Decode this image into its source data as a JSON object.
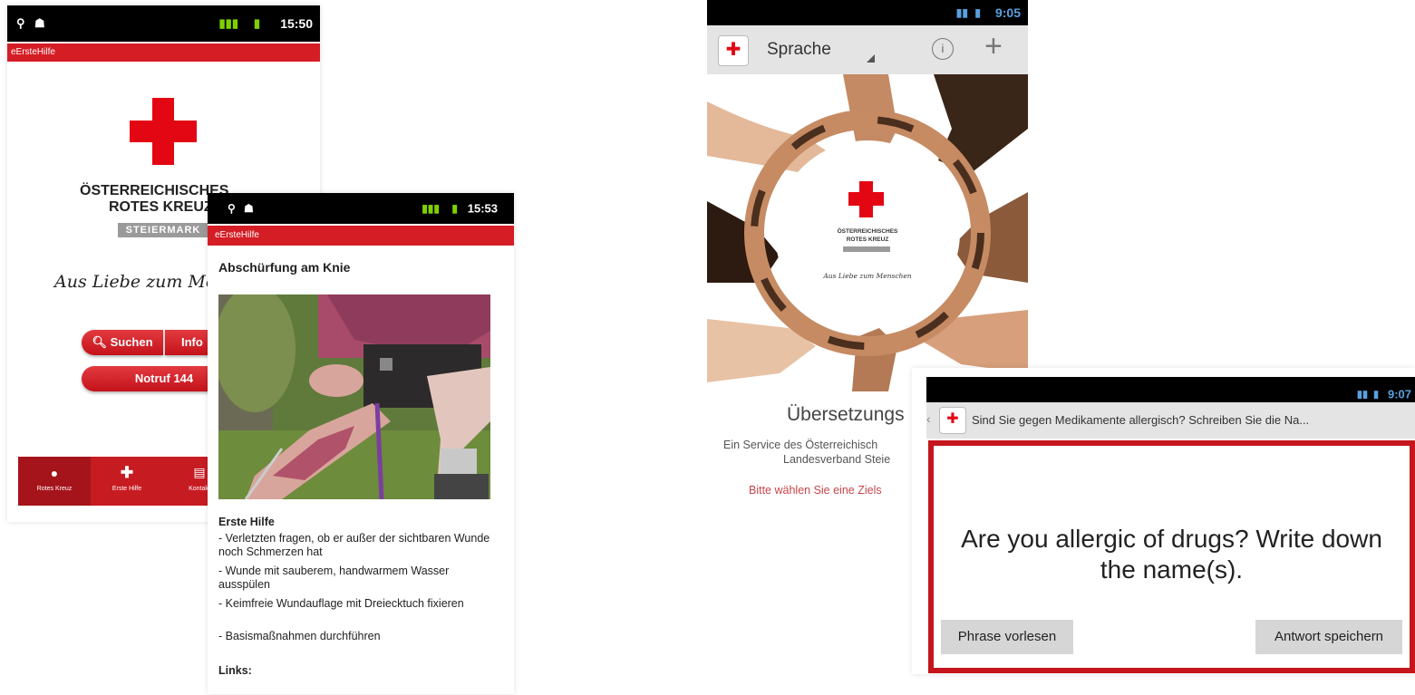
{
  "shot1": {
    "status_time": "15:50",
    "app_title": "eErsteHilfe",
    "org_line1": "ÖSTERREICHISCHES",
    "org_line2": "ROTES KREUZ",
    "org_region": "STEIERMARK",
    "slogan": "Aus Liebe zum Menschen",
    "search_label": "Suchen",
    "info_label": "Info",
    "emergency_label": "Notruf 144",
    "nav": [
      "Rotes Kreuz",
      "Erste Hilfe",
      "Kontakt"
    ]
  },
  "shot2": {
    "status_time": "15:53",
    "app_title": "eErsteHilfe",
    "heading": "Abschürfung am Knie",
    "section": "Erste Hilfe",
    "items": [
      "- Verletzten fragen, ob er außer der sichtbaren Wunde noch Schmerzen hat",
      "- Wunde mit sauberem, handwarmem Wasser ausspülen",
      "- Keimfreie Wundauflage mit Dreiecktuch fixieren",
      "- Basismaßnahmen durchführen"
    ],
    "links_label": "Links:"
  },
  "shot3": {
    "status_time": "9:05",
    "toolbar_title": "Sprache",
    "org_line1": "ÖSTERREICHISCHES",
    "org_line2": "ROTES KREUZ",
    "slogan": "Aus Liebe zum Menschen",
    "heading": "Übersetzungs",
    "service_line1": "Ein Service des Österreichisch",
    "service_line2": "Landesverband Steie",
    "choose_prompt": "Bitte wählen Sie eine Ziels"
  },
  "shot4": {
    "status_time": "9:07",
    "question_de": "Sind Sie gegen Medikamente allergisch? Schreiben Sie die Na...",
    "question_en": "Are you allergic of drugs? Write down the name(s).",
    "read_button": "Phrase vorlesen",
    "save_button": "Antwort speichern"
  },
  "colors": {
    "red": "#d51d25",
    "cross": "#e30613"
  },
  "icons": [
    "gps-icon",
    "android-icon",
    "signal-icon",
    "battery-icon",
    "search-icon",
    "info-icon",
    "plus-icon",
    "red-cross-icon"
  ]
}
